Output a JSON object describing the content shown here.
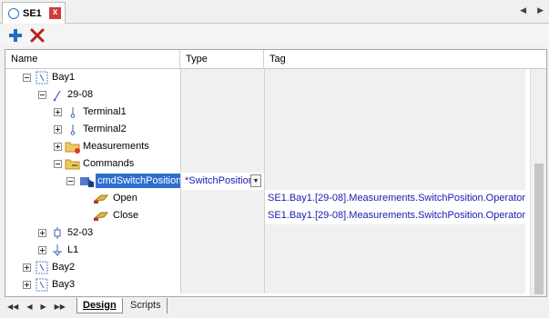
{
  "document_tab": {
    "title": "SE1",
    "close_label": "x"
  },
  "toolbar": {
    "add_label": "Add",
    "delete_label": "Delete"
  },
  "columns": {
    "name": "Name",
    "type": "Type",
    "tag": "Tag"
  },
  "tree": [
    {
      "label": "Bay1",
      "type": "",
      "tag": ""
    },
    {
      "label": "29-08",
      "type": "",
      "tag": ""
    },
    {
      "label": "Terminal1",
      "type": "",
      "tag": ""
    },
    {
      "label": "Terminal2",
      "type": "",
      "tag": ""
    },
    {
      "label": "Measurements",
      "type": "",
      "tag": ""
    },
    {
      "label": "Commands",
      "type": "",
      "tag": ""
    },
    {
      "label": "cmdSwitchPosition",
      "type": "*SwitchPosition",
      "tag": ""
    },
    {
      "label": "Open",
      "type": "",
      "tag": "SE1.Bay1.[29-08].Measurements.SwitchPosition.Operator"
    },
    {
      "label": "Close",
      "type": "",
      "tag": "SE1.Bay1.[29-08].Measurements.SwitchPosition.Operator"
    },
    {
      "label": "52-03",
      "type": "",
      "tag": ""
    },
    {
      "label": "L1",
      "type": "",
      "tag": ""
    },
    {
      "label": "Bay2",
      "type": "",
      "tag": ""
    },
    {
      "label": "Bay3",
      "type": "",
      "tag": ""
    }
  ],
  "bottom_tabs": {
    "design": "Design",
    "scripts": "Scripts"
  },
  "colors": {
    "selection": "#2e6fce",
    "tag_text": "#1a1ab0",
    "close_red": "#d23a3a",
    "add_blue": "#1f6fc4"
  }
}
